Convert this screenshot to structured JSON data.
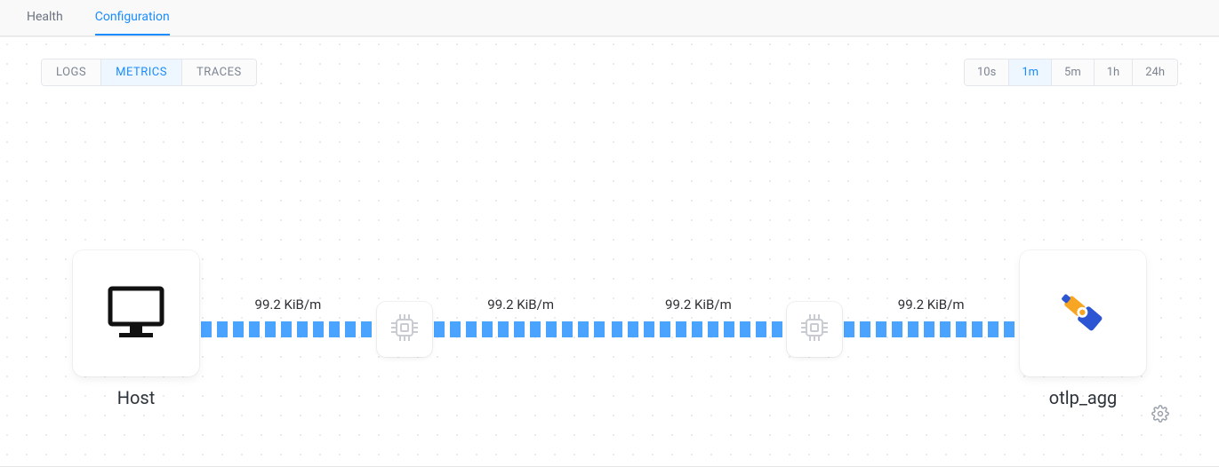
{
  "header": {
    "tabs": [
      {
        "label": "Health",
        "active": false
      },
      {
        "label": "Configuration",
        "active": true
      }
    ]
  },
  "pipeline_type_tabs": [
    {
      "label": "LOGS",
      "active": false
    },
    {
      "label": "METRICS",
      "active": true
    },
    {
      "label": "TRACES",
      "active": false
    }
  ],
  "time_tabs": [
    {
      "label": "10s",
      "active": false
    },
    {
      "label": "1m",
      "active": true
    },
    {
      "label": "5m",
      "active": false
    },
    {
      "label": "1h",
      "active": false
    },
    {
      "label": "24h",
      "active": false
    }
  ],
  "pipeline": {
    "source": {
      "label": "Host",
      "icon": "monitor-icon"
    },
    "segments": [
      {
        "rate": "99.2 KiB/m"
      },
      {
        "rate": "99.2 KiB/m"
      },
      {
        "rate": "99.2 KiB/m"
      },
      {
        "rate": "99.2 KiB/m"
      }
    ],
    "processors": [
      {
        "icon": "chip-icon"
      },
      {
        "icon": "chip-icon"
      }
    ],
    "destination": {
      "label": "otlp_agg",
      "icon": "telescope-icon"
    }
  }
}
